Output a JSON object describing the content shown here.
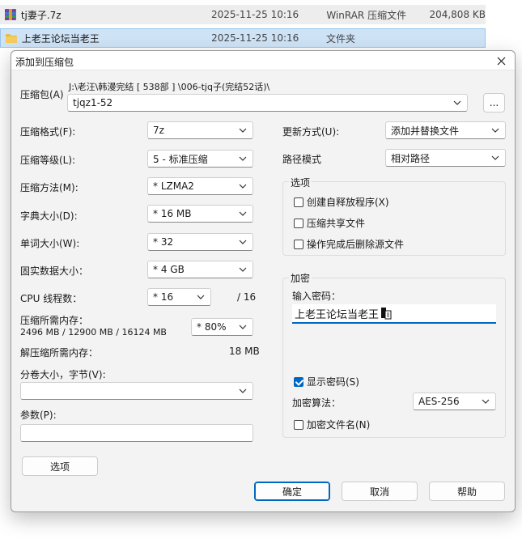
{
  "file_list": [
    {
      "name": "tj妻子.7z",
      "date": "2025-11-25 10:16",
      "type": "WinRAR 压缩文件",
      "size": "204,808 KB",
      "icon": "rar-archive-icon"
    },
    {
      "name": "上老王论坛当老王",
      "date": "2025-11-25 10:16",
      "type": "文件夹",
      "size": "",
      "icon": "folder-icon"
    }
  ],
  "dialog": {
    "title": "添加到压缩包",
    "archive_label": "压缩包(A)",
    "archive_path": "J:\\老汪\\韩漫完结 [ 538部 ] \\006-tjq子(完结52话)\\",
    "archive_name": "tjqz1-52",
    "browse_label": "...",
    "format_label": "压缩格式(F):",
    "format_value": "7z",
    "level_label": "压缩等级(L):",
    "level_value": "5 - 标准压缩",
    "method_label": "压缩方法(M):",
    "method_value": "*  LZMA2",
    "dict_label": "字典大小(D):",
    "dict_value": "*  16 MB",
    "word_label": "单词大小(W):",
    "word_value": "*  32",
    "solid_label": "固实数据大小：",
    "solid_value": "*  4 GB",
    "cpu_label": "CPU 线程数：",
    "cpu_value": "*  16",
    "cpu_max": "/ 16",
    "mem_label": "压缩所需内存：",
    "mem_detail": "2496 MB / 12900 MB / 16124 MB",
    "mem_value": "*  80%",
    "decomp_label": "解压缩所需内存：",
    "decomp_value": "18 MB",
    "split_label": "分卷大小，字节(V):",
    "split_value": "",
    "params_label": "参数(P):",
    "params_value": "",
    "options_button": "选项",
    "update_label": "更新方式(U):",
    "update_value": "添加并替换文件",
    "path_label": "路径模式",
    "path_value": "相对路径",
    "options_group": "选项",
    "opt_sfx": "创建自释放程序(X)",
    "opt_shared": "压缩共享文件",
    "opt_delete": "操作完成后删除源文件",
    "encrypt_group": "加密",
    "password_label": "输入密码：",
    "password_value": "上老王论坛当老王",
    "show_password": "显示密码(S)",
    "enc_method_label": "加密算法：",
    "enc_method_value": "AES-256",
    "encrypt_names": "加密文件名(N)",
    "ok_button": "确定",
    "cancel_button": "取消",
    "help_button": "帮助"
  },
  "colors": {
    "accent": "#0067c0",
    "selection": "#cfe3f7"
  }
}
